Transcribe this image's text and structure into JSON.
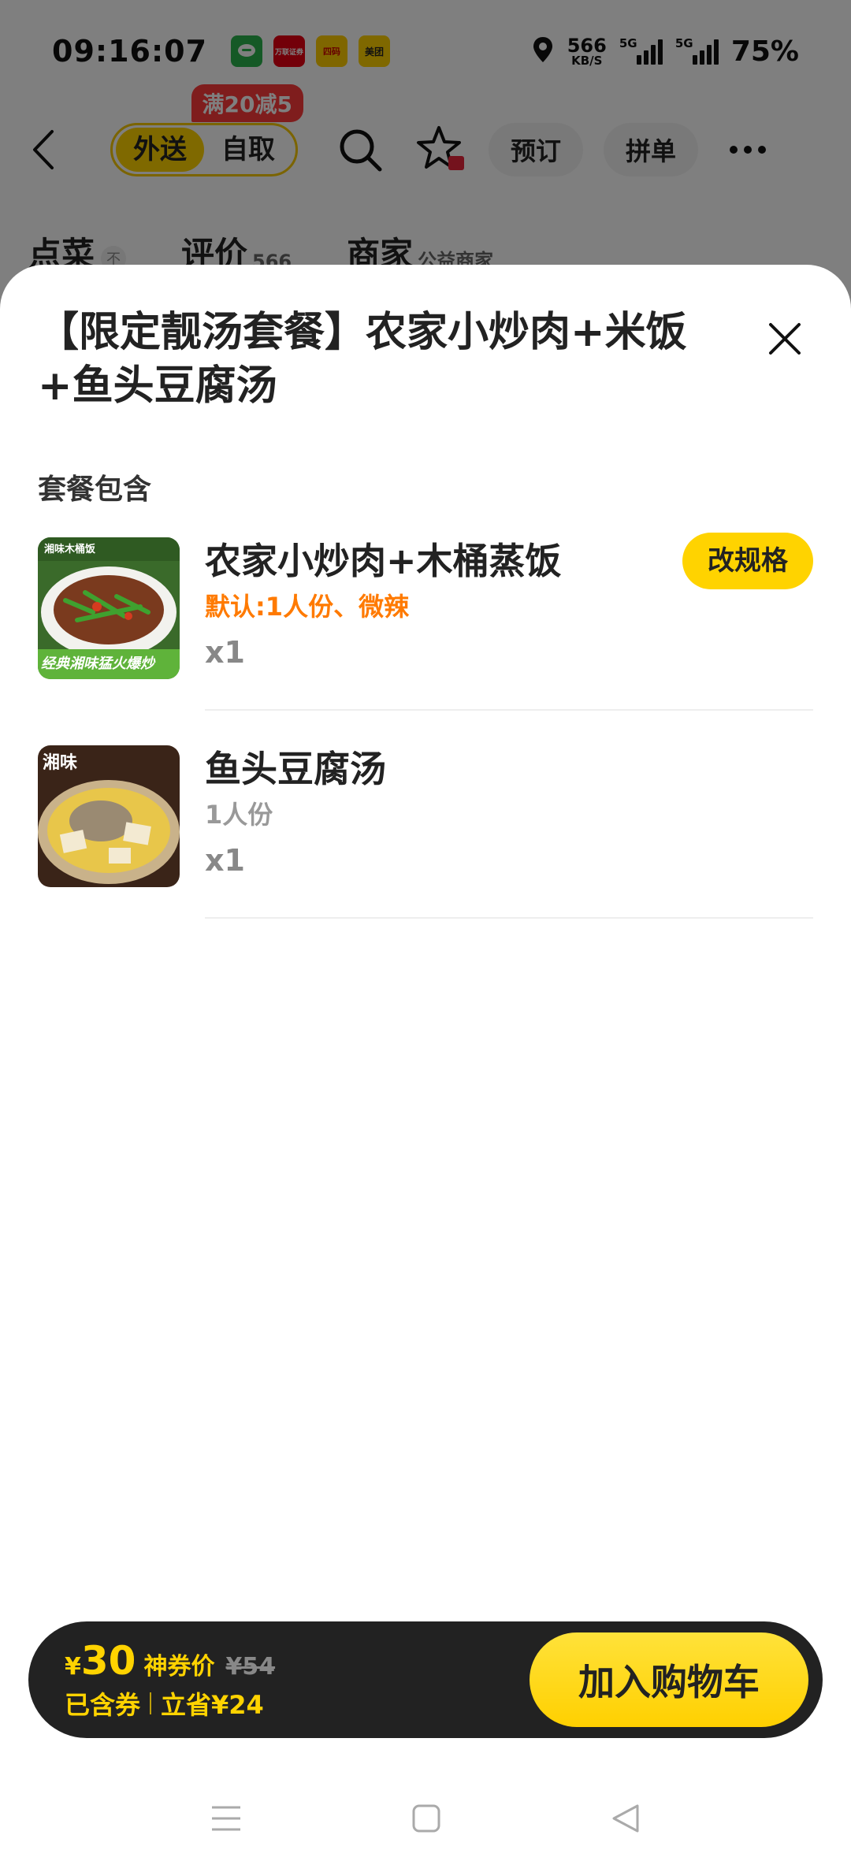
{
  "status_bar": {
    "time": "09:16:07",
    "apps": [
      {
        "icon": "wechat-icon",
        "color": "#2bb24c",
        "label": ""
      },
      {
        "icon": "securities-icon",
        "color": "#e60012",
        "label": "万联证券"
      },
      {
        "icon": "game-icon",
        "color": "#ffcc00",
        "label": "四码"
      },
      {
        "icon": "meituan-icon",
        "color": "#ffd100",
        "label": "美团"
      }
    ],
    "speed_value": "566",
    "speed_unit": "KB/S",
    "sim1_label": "5G",
    "sim2_label": "5G",
    "battery": "75%"
  },
  "navbar": {
    "mode_delivery": "外送",
    "mode_pickup": "自取",
    "promo": "满20减5",
    "reserve": "预订",
    "group_order": "拼单"
  },
  "tabs": {
    "order": "点菜",
    "order_badge": "不",
    "reviews": "评价",
    "reviews_count": "566",
    "merchant": "商家",
    "merchant_sub": "公益商家"
  },
  "sheet": {
    "title": "【限定靓汤套餐】农家小炒肉+米饭+鱼头豆腐汤",
    "section_title": "套餐包含",
    "items": [
      {
        "name": "农家小炒肉+木桶蒸饭",
        "spec": "默认:1人份、微辣",
        "qty": "x1",
        "action": "改规格",
        "thumb_caption": "经典湘味猛火爆炒",
        "thumb_tag": "湘味木桶饭"
      },
      {
        "name": "鱼头豆腐汤",
        "spec": "1人份",
        "qty": "x1",
        "thumb_tag": "湘味"
      }
    ]
  },
  "bottom_bar": {
    "currency": "¥",
    "price": "30",
    "price_label": "神券价",
    "original_price": "¥54",
    "coupon_included": "已含券",
    "saved": "立省¥24",
    "add_to_cart": "加入购物车"
  },
  "colors": {
    "brand_yellow": "#ffd300",
    "promo_red": "#ff3b3b",
    "spec_orange": "#ff7a00",
    "bar_dark": "#222222"
  }
}
